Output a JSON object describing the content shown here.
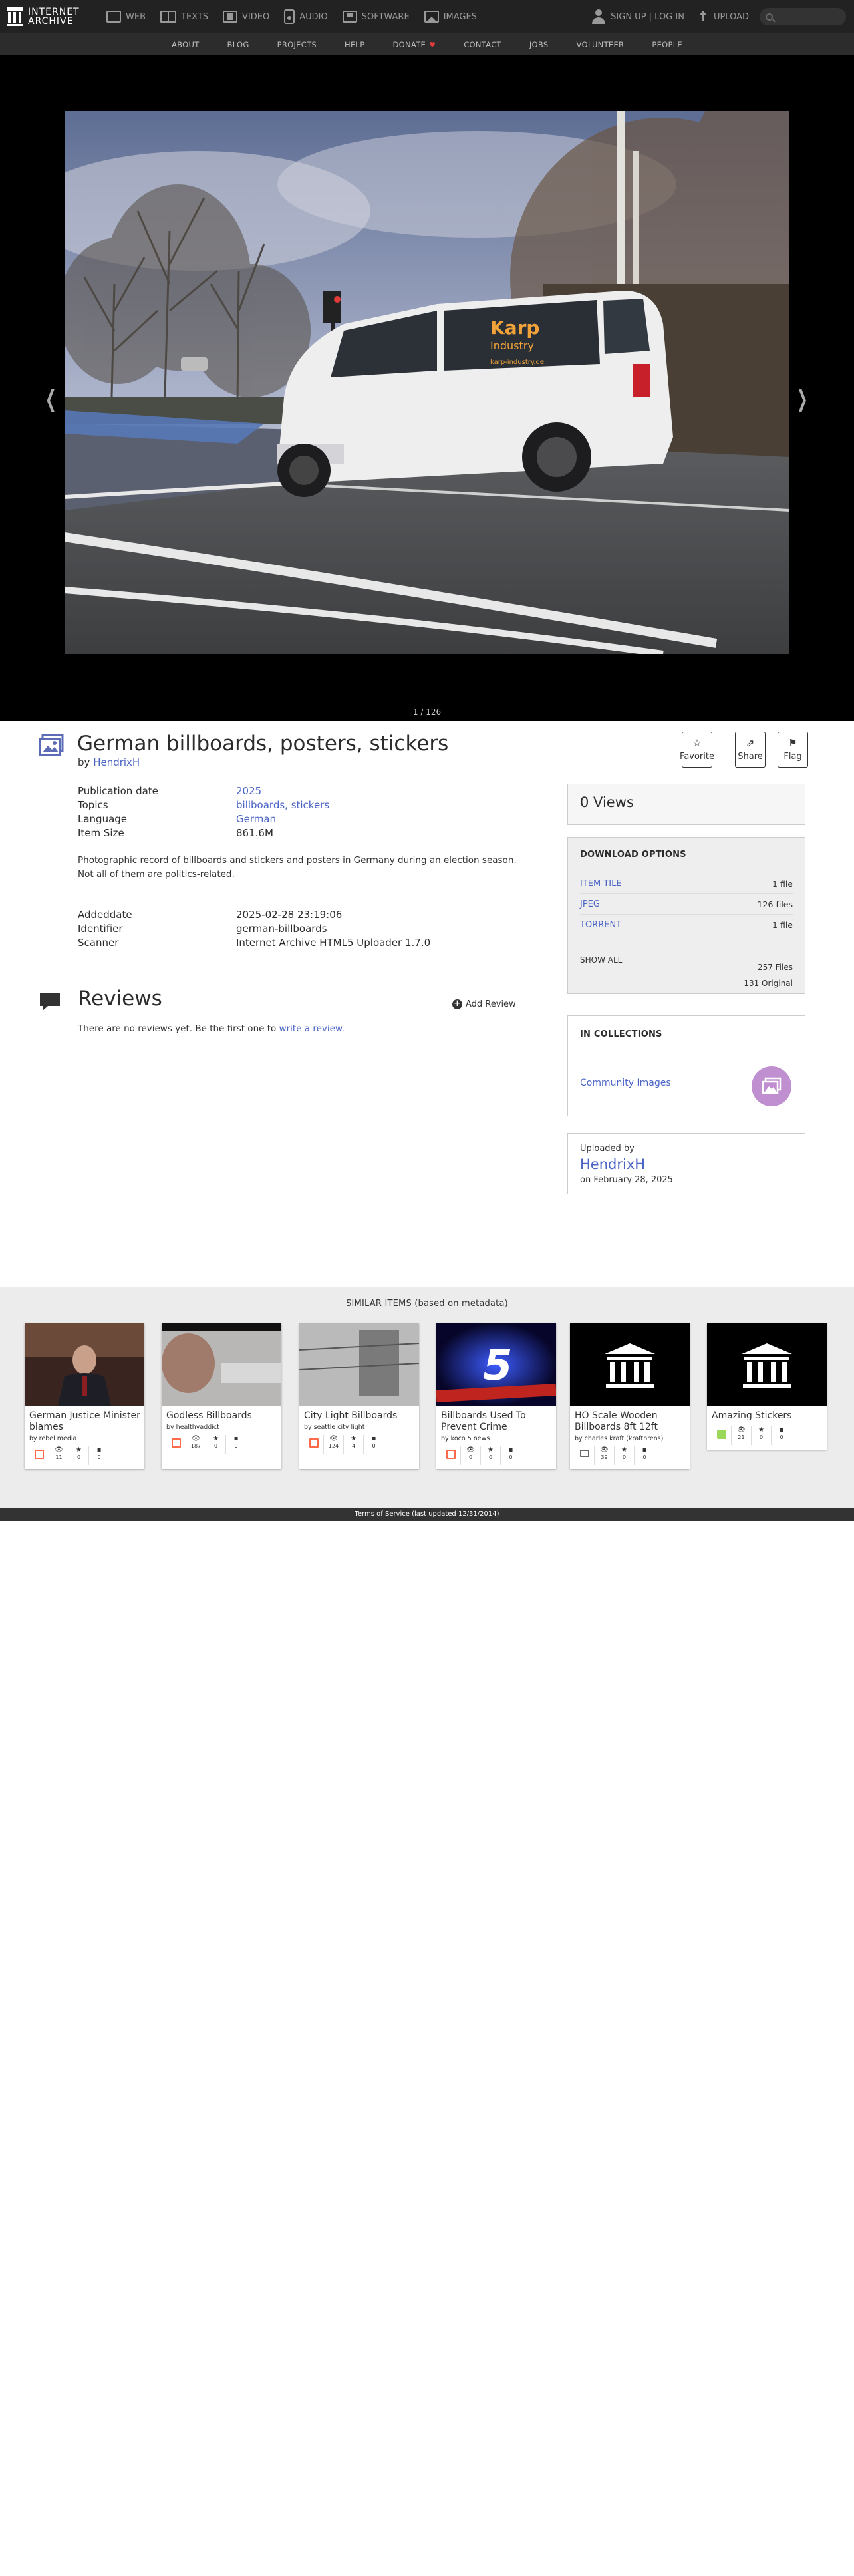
{
  "topnav": {
    "logo_line1": "INTERNET",
    "logo_line2": "ARCHIVE",
    "media": [
      {
        "label": "WEB",
        "icon": "web-icon"
      },
      {
        "label": "TEXTS",
        "icon": "book-icon"
      },
      {
        "label": "VIDEO",
        "icon": "film-icon"
      },
      {
        "label": "AUDIO",
        "icon": "speaker-icon"
      },
      {
        "label": "SOFTWARE",
        "icon": "floppy-icon"
      },
      {
        "label": "IMAGES",
        "icon": "image-icon"
      }
    ],
    "signin": "SIGN UP | LOG IN",
    "upload": "UPLOAD",
    "search_placeholder": "Search"
  },
  "subnav": [
    "ABOUT",
    "BLOG",
    "PROJECTS",
    "HELP",
    "DONATE",
    "CONTACT",
    "JOBS",
    "VOLUNTEER",
    "PEOPLE"
  ],
  "viewer": {
    "page_count": "1 / 126",
    "van_brand": "Karp",
    "van_brand2": "Industry",
    "van_url": "karp-industry.de"
  },
  "item": {
    "title": "German billboards, posters, stickers",
    "by_label": "by",
    "author": "HendrixH",
    "actions": [
      {
        "label": "Favorite",
        "icon": "star-icon"
      },
      {
        "label": "Share",
        "icon": "share-icon"
      },
      {
        "label": "Flag",
        "icon": "flag-icon"
      }
    ],
    "metadata": [
      {
        "key": "Publication date",
        "value": "2025",
        "link": true
      },
      {
        "key": "Topics",
        "value": "billboards, stickers",
        "link": true
      },
      {
        "key": "Language",
        "value": "German",
        "link": true
      },
      {
        "key": "Item Size",
        "value": "861.6M",
        "link": false
      }
    ],
    "description": [
      "Photographic record of billboards and stickers and posters in Germany during an election season.",
      "Not all of them are politics-related."
    ],
    "metadata2": [
      {
        "key": "Addeddate",
        "value": "2025-02-28 23:19:06"
      },
      {
        "key": "Identifier",
        "value": "german-billboards"
      },
      {
        "key": "Scanner",
        "value": "Internet Archive HTML5 Uploader 1.7.0"
      }
    ]
  },
  "reviews": {
    "title": "Reviews",
    "add_label": "Add Review",
    "empty_text": "There are no reviews yet. Be the first one to ",
    "empty_link": "write a review."
  },
  "sidebar": {
    "views": "0 Views",
    "download_heading": "DOWNLOAD OPTIONS",
    "downloads": [
      {
        "label": "ITEM TILE",
        "count": "1 file"
      },
      {
        "label": "JPEG",
        "count": "126 files"
      },
      {
        "label": "TORRENT",
        "count": "1 file"
      }
    ],
    "show_all": "SHOW ALL",
    "total_files": "257 Files",
    "original_files": "131 Original",
    "collections_heading": "IN COLLECTIONS",
    "collection_name": "Community Images",
    "uploaded_by_label": "Uploaded by",
    "uploader": "HendrixH",
    "upload_date": "on February 28, 2025"
  },
  "similar": {
    "title": "SIMILAR ITEMS (based on metadata)",
    "items": [
      {
        "title": "German Justice Minister blames",
        "by": "by rebel media",
        "type": "movie",
        "views": "11",
        "favs": "0",
        "reviews": "0"
      },
      {
        "title": "Godless Billboards",
        "by": "by healthyaddict",
        "type": "movie",
        "views": "187",
        "favs": "0",
        "reviews": "0"
      },
      {
        "title": "City Light Billboards",
        "by": "by seattle city light",
        "type": "movie",
        "views": "124",
        "favs": "4",
        "reviews": "0"
      },
      {
        "title": "Billboards Used To Prevent Crime",
        "by": "by koco 5 news",
        "type": "movie",
        "views": "0",
        "favs": "0",
        "reviews": "0"
      },
      {
        "title": "HO Scale Wooden Billboards 8ft 12ft",
        "by": "by charles kraft (kraftbrens)",
        "type": "folder",
        "views": "39",
        "favs": "0",
        "reviews": "0"
      },
      {
        "title": "Amazing Stickers",
        "by": "",
        "type": "img",
        "views": "21",
        "favs": "0",
        "reviews": "0"
      }
    ]
  },
  "footer": "Terms of Service (last updated 12/31/2014)"
}
